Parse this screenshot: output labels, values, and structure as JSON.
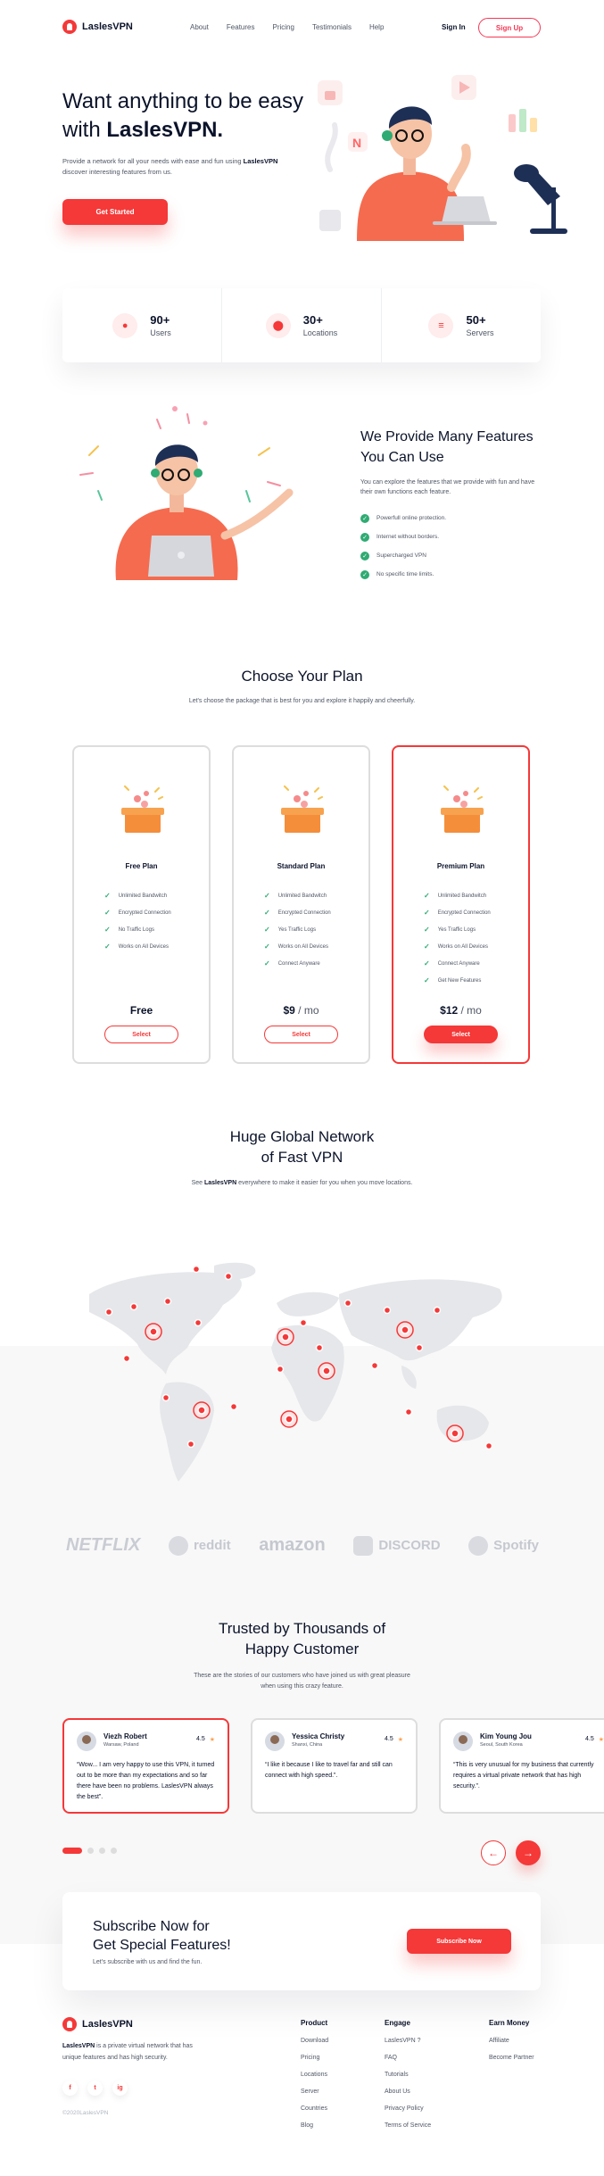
{
  "brand": {
    "name": "LaslesVPN"
  },
  "nav": {
    "links": [
      "About",
      "Features",
      "Pricing",
      "Testimonials",
      "Help"
    ],
    "signin": "Sign In",
    "signup": "Sign Up"
  },
  "hero": {
    "title_a": "Want anything to be easy with ",
    "title_b": "LaslesVPN.",
    "desc_a": "Provide a network for all your needs with ease and fun using ",
    "desc_b": "LaslesVPN",
    "desc_c": " discover interesting features from us.",
    "cta": "Get Started"
  },
  "stats": [
    {
      "num": "90+",
      "label": "Users",
      "icon": "user-icon"
    },
    {
      "num": "30+",
      "label": "Locations",
      "icon": "location-icon"
    },
    {
      "num": "50+",
      "label": "Servers",
      "icon": "server-icon"
    }
  ],
  "features": {
    "title": "We Provide Many Features You Can Use",
    "desc": "You can explore the features that we provide with fun and have their own functions each feature.",
    "items": [
      "Powerfull online protection.",
      "Internet without borders.",
      "Supercharged VPN",
      "No specific time limits."
    ]
  },
  "plans": {
    "title": "Choose Your Plan",
    "sub": "Let's choose the package that is best for you and explore it happily and cheerfully.",
    "items": [
      {
        "name": "Free Plan",
        "features": [
          "Unlimited Bandwitch",
          "Encrypted Connection",
          "No Traffic Logs",
          "Works on All Devices"
        ],
        "price": "Free",
        "per": "",
        "button": "Select"
      },
      {
        "name": "Standard Plan",
        "features": [
          "Unlimited Bandwitch",
          "Encrypted Connection",
          "Yes Traffic Logs",
          "Works on All Devices",
          "Connect Anyware"
        ],
        "price": "$9",
        "per": " / mo",
        "button": "Select"
      },
      {
        "name": "Premium Plan",
        "features": [
          "Unlimited Bandwitch",
          "Encrypted Connection",
          "Yes Traffic Logs",
          "Works on All Devices",
          "Connect Anyware",
          "Get New Features"
        ],
        "price": "$12",
        "per": " / mo",
        "button": "Select"
      }
    ]
  },
  "network": {
    "title_1": "Huge Global Network",
    "title_2": "of Fast VPN",
    "sub_a": "See ",
    "sub_b": "LaslesVPN",
    "sub_c": " everywhere to make it easier for you when you move locations."
  },
  "brands": [
    "NETFLIX",
    "reddit",
    "amazon",
    "DISCORD",
    "Spotify"
  ],
  "testimonials": {
    "title_1": "Trusted by Thousands of",
    "title_2": "Happy Customer",
    "sub": "These are the stories of our customers who have joined us with great pleasure when using this crazy feature.",
    "items": [
      {
        "name": "Viezh Robert",
        "loc": "Warsaw, Poland",
        "rating": "4.5",
        "text": "“Wow... I am very happy to use this VPN, it turned out to be more than my expectations and so far there have been no problems. LaslesVPN always the best”."
      },
      {
        "name": "Yessica Christy",
        "loc": "Shanxi, China",
        "rating": "4.5",
        "text": "“I like it because I like to travel far and still can connect with high speed.”."
      },
      {
        "name": "Kim Young Jou",
        "loc": "Seoul, South Korea",
        "rating": "4.5",
        "text": "“This is very unusual for my business that currently requires a virtual private network that has high security.”."
      }
    ],
    "prev_icon": "arrow-left-icon",
    "next_icon": "arrow-right-icon"
  },
  "subscribe": {
    "title_1": "Subscribe Now for",
    "title_2": "Get Special Features!",
    "desc": "Let's subscribe with us and find the fun.",
    "button": "Subscribe Now"
  },
  "footer": {
    "brand": "LaslesVPN",
    "desc_b": "LaslesVPN",
    "desc": " is a private virtual network that has unique features and has high security.",
    "socials": [
      "f",
      "t",
      "ig"
    ],
    "copyright": "©2020LaslesVPN",
    "columns": [
      {
        "title": "Product",
        "items": [
          "Download",
          "Pricing",
          "Locations",
          "Server",
          "Countries",
          "Blog"
        ]
      },
      {
        "title": "Engage",
        "items": [
          "LaslesVPN ?",
          "FAQ",
          "Tutorials",
          "About Us",
          "Privacy Policy",
          "Terms of Service"
        ]
      },
      {
        "title": "Earn Money",
        "items": [
          "Affiliate",
          "Become Partner"
        ]
      }
    ]
  },
  "colors": {
    "accent": "#f53838",
    "ink": "#0b132a",
    "muted": "#4f5665",
    "check": "#2fab73",
    "star": "#fea250"
  }
}
